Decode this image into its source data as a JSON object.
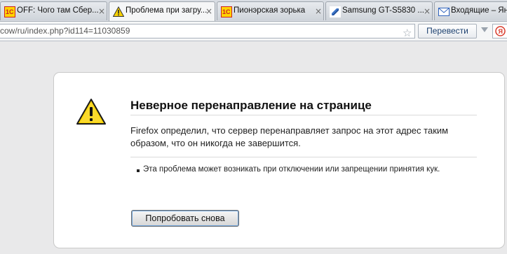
{
  "browser": {
    "tabs": [
      {
        "title": "OFF: Чого там Сбер...",
        "icon": "1c-logo-icon",
        "active": false
      },
      {
        "title": "Проблема при загру...",
        "icon": "warning-icon",
        "active": true
      },
      {
        "title": "Пионэрская зорька",
        "icon": "1c-logo-icon",
        "active": false
      },
      {
        "title": "Samsung GT-S5830 ...",
        "icon": "samsung-icon",
        "active": false
      },
      {
        "title": "Входящие – Ян",
        "icon": "mail-icon",
        "active": false
      }
    ],
    "close_glyph": "×",
    "favicon_1c_text": "1С",
    "address_bar": {
      "url": "cow/ru/index.php?id114=11030859",
      "translate_label": "Перевести"
    }
  },
  "error_page": {
    "title": "Неверное перенаправление на странице",
    "description": "Firefox определил, что сервер перенаправляет запрос на этот адрес таким образом, что он никогда не завершится.",
    "details": [
      "Эта проблема может возникать при отключении или запрещении принятия кук."
    ],
    "retry_label": "Попробовать снова"
  },
  "colors": {
    "warning_yellow": "#f6d100",
    "warning_border": "#222222",
    "page_background": "#e9e9ea"
  }
}
